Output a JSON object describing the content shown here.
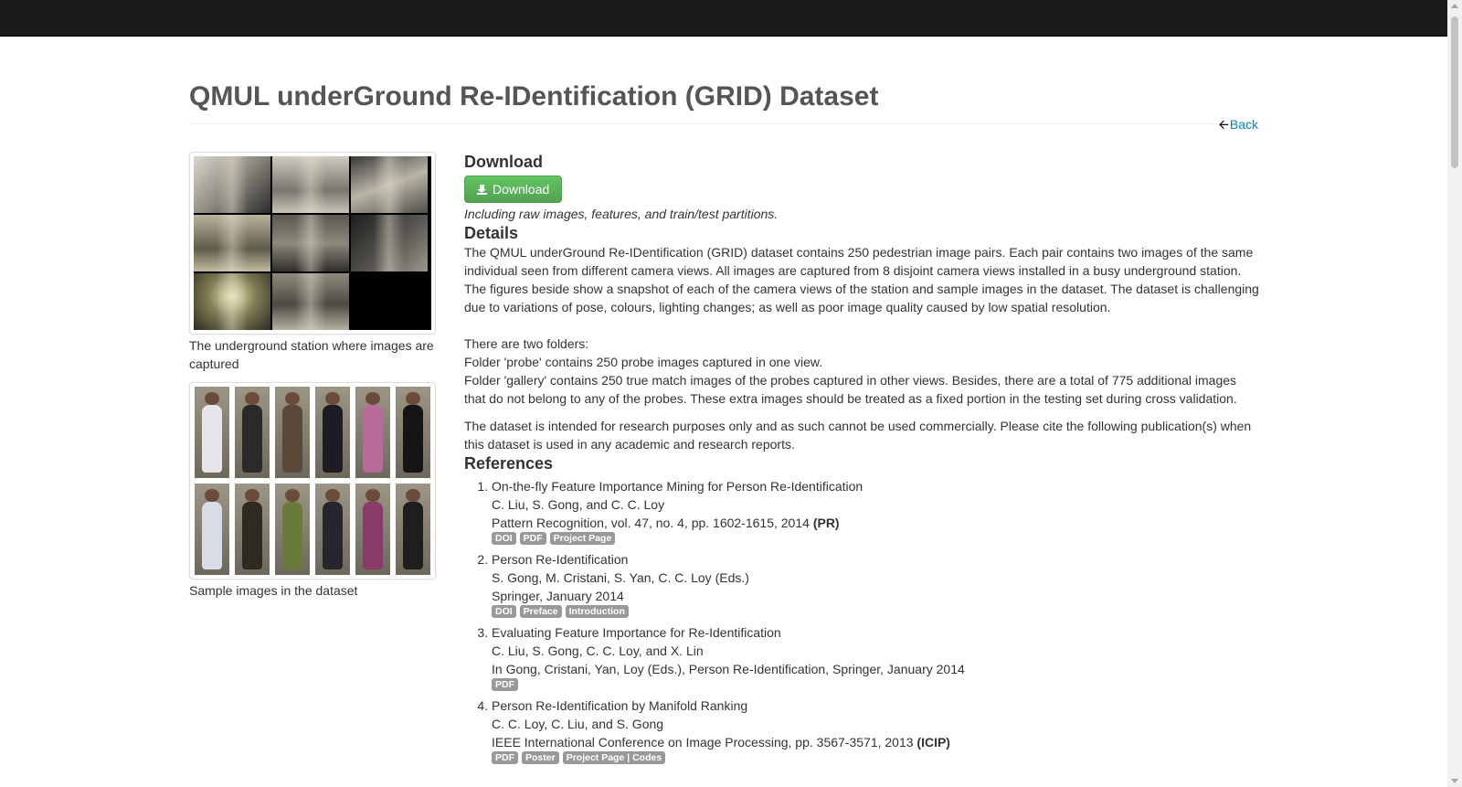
{
  "page": {
    "title": "QMUL underGround Re-IDentification (GRID) Dataset",
    "back_label": "Back"
  },
  "sidebar": {
    "station_caption": "The underground station where images are captured",
    "samples_caption": "Sample images in the dataset"
  },
  "download": {
    "heading": "Download",
    "button_label": "Download",
    "note": "Including raw images, features, and train/test partitions."
  },
  "details": {
    "heading": "Details",
    "paragraph1": "The QMUL underGround Re-IDentification (GRID) dataset contains 250 pedestrian image pairs. Each pair contains two images of the same individual seen from different camera views. All images are captured from 8 disjoint camera views installed in a busy underground station. The figures beside show a snapshot of each of the camera views of the station and sample images in the dataset. The dataset is challenging due to variations of pose, colours, lighting changes; as well as poor image quality caused by low spatial resolution.",
    "folders_intro": "There are two folders:",
    "folder_probe": "Folder 'probe' contains 250 probe images captured in one view.",
    "folder_gallery": "Folder 'gallery' contains 250 true match images of the probes captured in other views. Besides, there are a total of 775 additional images that do not belong to any of the probes. These extra images should be treated as a fixed portion in the testing set during cross validation.",
    "usage": "The dataset is intended for research purposes only and as such cannot be used commercially. Please cite the following publication(s) when this dataset is used in any academic and research reports."
  },
  "references": {
    "heading": "References",
    "items": [
      {
        "title": "On-the-fly Feature Importance Mining for Person Re-Identification",
        "authors": "C. Liu, S. Gong, and C. C. Loy",
        "venue": "Pattern Recognition, vol. 47, no. 4, pp. 1602-1615, 2014",
        "venue_abbr": "(PR)",
        "labels": [
          "DOI",
          "PDF",
          "Project Page"
        ]
      },
      {
        "title": "Person Re-Identification",
        "authors": "S. Gong, M. Cristani, S. Yan, C. C. Loy (Eds.)",
        "venue": "Springer, January 2014",
        "venue_abbr": "",
        "labels": [
          "DOI",
          "Preface",
          "Introduction"
        ]
      },
      {
        "title": "Evaluating Feature Importance for Re-Identification",
        "authors": "C. Liu, S. Gong, C. C. Loy, and X. Lin",
        "venue": "In Gong, Cristani, Yan, Loy (Eds.), Person Re-Identification, Springer, January 2014",
        "venue_abbr": "",
        "labels": [
          "PDF"
        ]
      },
      {
        "title": "Person Re-Identification by Manifold Ranking",
        "authors": "C. C. Loy, C. Liu, and S. Gong",
        "venue": "IEEE International Conference on Image Processing, pp. 3567-3571, 2013",
        "venue_abbr": "(ICIP)",
        "labels": [
          "PDF",
          "Poster",
          "Project Page | Codes"
        ]
      }
    ]
  },
  "colors": {
    "topbar": "#1b1b1b",
    "link": "#0088cc",
    "button": "#51a351",
    "label": "#999999"
  }
}
